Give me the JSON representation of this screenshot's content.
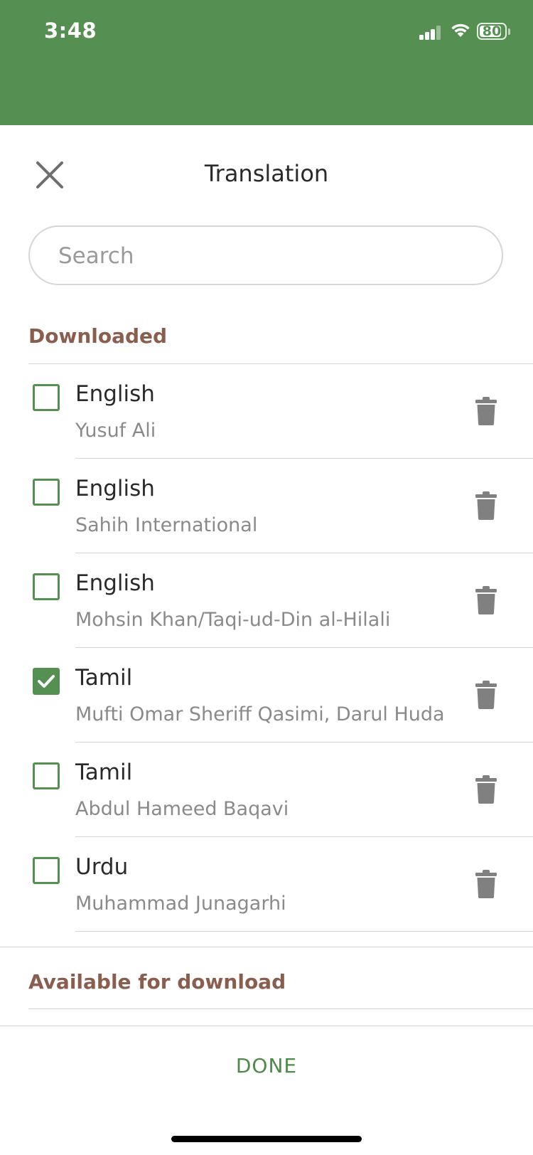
{
  "status_bar": {
    "time": "3:48",
    "battery": "80",
    "signal_icon": "signal-icon",
    "wifi_icon": "wifi-icon"
  },
  "header": {
    "title": "Translation",
    "close_icon": "close-icon"
  },
  "search": {
    "placeholder": "Search",
    "value": ""
  },
  "sections": {
    "downloaded": "Downloaded",
    "available": "Available for download"
  },
  "downloaded_items": [
    {
      "language": "English",
      "author": "Yusuf Ali",
      "checked": false
    },
    {
      "language": "English",
      "author": "Sahih International",
      "checked": false
    },
    {
      "language": "English",
      "author": "Mohsin Khan/Taqi-ud-Din al-Hilali",
      "checked": false
    },
    {
      "language": "Tamil",
      "author": "Mufti Omar Sheriff Qasimi, Darul Huda",
      "checked": true
    },
    {
      "language": "Tamil",
      "author": "Abdul Hameed Baqavi",
      "checked": false
    },
    {
      "language": "Urdu",
      "author": "Muhammad Junagarhi",
      "checked": false
    }
  ],
  "footer": {
    "done_label": "DONE"
  },
  "colors": {
    "accent": "#558f52",
    "section_header": "#8a5e4e",
    "icon_gray": "#808080"
  }
}
